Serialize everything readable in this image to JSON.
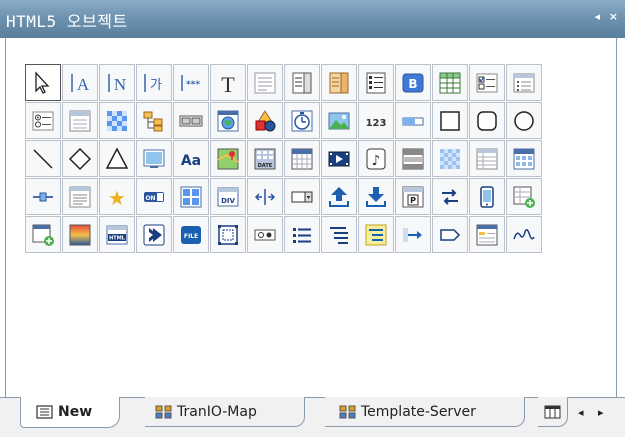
{
  "panel": {
    "title": "HTML5 오브젝트",
    "collapse_icon": "◂",
    "close_icon": "×"
  },
  "tabs": [
    {
      "label": "New",
      "icon": "form-icon"
    },
    {
      "label": "TranIO-Map",
      "icon": "map-icon"
    },
    {
      "label": "Template-Server",
      "icon": "map-icon"
    },
    {
      "label": "",
      "icon": "grid-icon"
    }
  ],
  "scroll": {
    "left": "◂",
    "right": "▸"
  },
  "icons": [
    {
      "name": "pointer",
      "label": ""
    },
    {
      "name": "label-a",
      "label": "A"
    },
    {
      "name": "label-n",
      "label": "N"
    },
    {
      "name": "label-ga",
      "label": "가"
    },
    {
      "name": "password-field",
      "label": "***"
    },
    {
      "name": "text",
      "label": "T"
    },
    {
      "name": "textarea",
      "label": ""
    },
    {
      "name": "list-spin",
      "label": ""
    },
    {
      "name": "combo-spin",
      "label": ""
    },
    {
      "name": "list-menu",
      "label": ""
    },
    {
      "name": "button-b",
      "label": "B"
    },
    {
      "name": "table",
      "label": ""
    },
    {
      "name": "checkbox-group",
      "label": ""
    },
    {
      "name": "grid-list",
      "label": ""
    },
    {
      "name": "radio-group",
      "label": ""
    },
    {
      "name": "form",
      "label": ""
    },
    {
      "name": "image-pattern",
      "label": ""
    },
    {
      "name": "tree",
      "label": ""
    },
    {
      "name": "toggle-boxes",
      "label": ""
    },
    {
      "name": "web-browser",
      "label": ""
    },
    {
      "name": "shapes-color",
      "label": ""
    },
    {
      "name": "timer",
      "label": ""
    },
    {
      "name": "picture",
      "label": ""
    },
    {
      "name": "numeric",
      "label": "123"
    },
    {
      "name": "progress-bar",
      "label": ""
    },
    {
      "name": "rectangle",
      "label": ""
    },
    {
      "name": "rounded-rectangle",
      "label": ""
    },
    {
      "name": "circle",
      "label": ""
    },
    {
      "name": "line",
      "label": ""
    },
    {
      "name": "diamond",
      "label": ""
    },
    {
      "name": "triangle",
      "label": ""
    },
    {
      "name": "screen",
      "label": ""
    },
    {
      "name": "font-aa",
      "label": "Aa"
    },
    {
      "name": "map",
      "label": ""
    },
    {
      "name": "date",
      "label": "DATE"
    },
    {
      "name": "calendar",
      "label": ""
    },
    {
      "name": "video",
      "label": ""
    },
    {
      "name": "audio",
      "label": "♪"
    },
    {
      "name": "panel-horizontal",
      "label": ""
    },
    {
      "name": "pattern-blue",
      "label": ""
    },
    {
      "name": "grid-doc",
      "label": ""
    },
    {
      "name": "grid-table",
      "label": ""
    },
    {
      "name": "slider",
      "label": ""
    },
    {
      "name": "text-doc",
      "label": ""
    },
    {
      "name": "star",
      "label": "★"
    },
    {
      "name": "switch-on",
      "label": "ON"
    },
    {
      "name": "split-panel",
      "label": ""
    },
    {
      "name": "div",
      "label": "DIV"
    },
    {
      "name": "resize-h",
      "label": ""
    },
    {
      "name": "select-combo",
      "label": ""
    },
    {
      "name": "upload",
      "label": ""
    },
    {
      "name": "download",
      "label": ""
    },
    {
      "name": "page-p",
      "label": "P"
    },
    {
      "name": "swap",
      "label": ""
    },
    {
      "name": "mobile",
      "label": ""
    },
    {
      "name": "add-grid",
      "label": ""
    },
    {
      "name": "add-calendar",
      "label": ""
    },
    {
      "name": "gradient",
      "label": ""
    },
    {
      "name": "html",
      "label": "HTML"
    },
    {
      "name": "next-arrow",
      "label": ""
    },
    {
      "name": "file",
      "label": "FILE"
    },
    {
      "name": "frame",
      "label": ""
    },
    {
      "name": "radio-box",
      "label": ""
    },
    {
      "name": "bullet-list",
      "label": ""
    },
    {
      "name": "indent-list",
      "label": ""
    },
    {
      "name": "indent-list-yellow",
      "label": ""
    },
    {
      "name": "arrow-right",
      "label": ""
    },
    {
      "name": "pentagon-arrow",
      "label": ""
    },
    {
      "name": "form-window",
      "label": ""
    },
    {
      "name": "wave",
      "label": ""
    }
  ]
}
